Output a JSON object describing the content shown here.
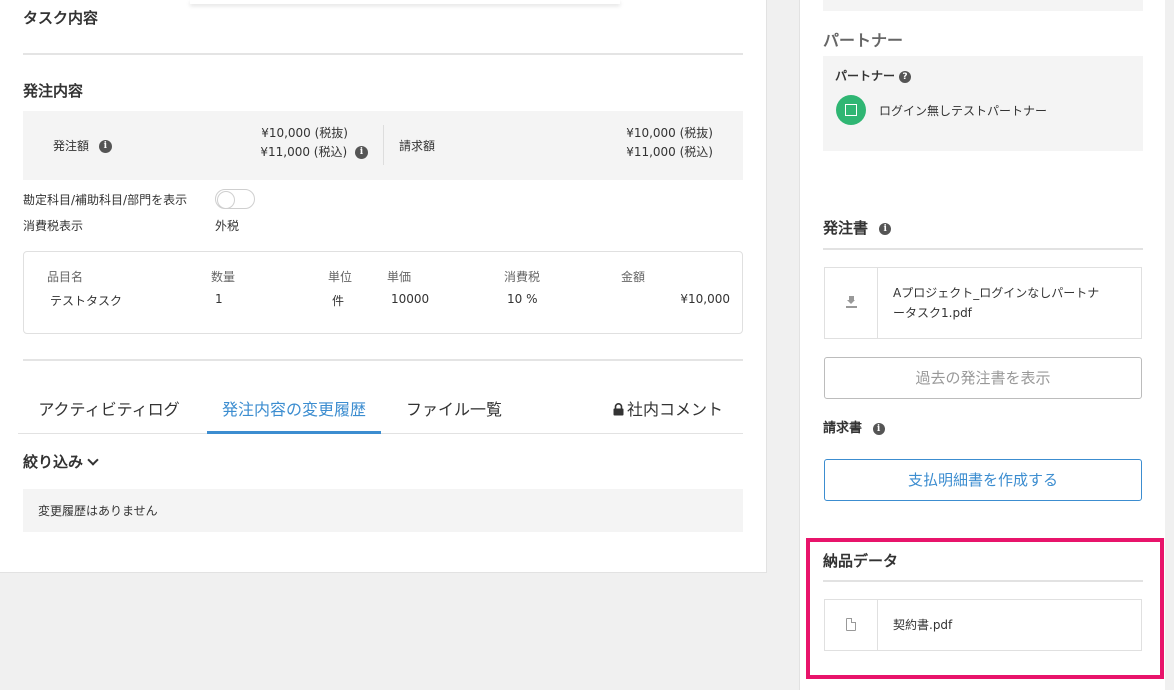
{
  "main": {
    "task_title": "タスク内容",
    "order_title": "発注内容",
    "summary": {
      "order_amount_label": "発注額",
      "order_amount_excl": "¥10,000 (税抜)",
      "order_amount_incl": "¥11,000 (税込)",
      "invoice_amount_label": "請求額",
      "invoice_amount_excl": "¥10,000 (税抜)",
      "invoice_amount_incl": "¥11,000 (税込)"
    },
    "show_accounts_label": "勘定科目/補助科目/部門を表示",
    "tax_display_label": "消費税表示",
    "tax_display_value": "外税",
    "items_table": {
      "headers": [
        "品目名",
        "数量",
        "単位",
        "単価",
        "消費税",
        "金額"
      ],
      "row": [
        "テストタスク",
        "1",
        "件",
        "10000",
        "10 %",
        "¥10,000"
      ]
    },
    "tabs": [
      {
        "label": "アクティビティログ"
      },
      {
        "label": "発注内容の変更履歴"
      },
      {
        "label": "ファイル一覧"
      },
      {
        "label": "社内コメント"
      }
    ],
    "filter_label": "絞り込み",
    "empty_history": "変更履歴はありません"
  },
  "sidebar": {
    "partner_section_title": "パートナー",
    "partner_label": "パートナー",
    "partner_name": "ログイン無しテストパートナー",
    "purchase_order_title": "発注書",
    "purchase_order_file_line1": "Aプロジェクト_ログインなしパートナ",
    "purchase_order_file_line2": "ータスク1.pdf",
    "past_orders_button": "過去の発注書を表示",
    "invoice_title": "請求書",
    "create_statement_button": "支払明細書を作成する",
    "delivery_title": "納品データ",
    "delivery_file": "契約書.pdf"
  },
  "colors": {
    "accent": "#3c8dd0",
    "highlight": "#e8146b",
    "avatar": "#2fb673"
  }
}
